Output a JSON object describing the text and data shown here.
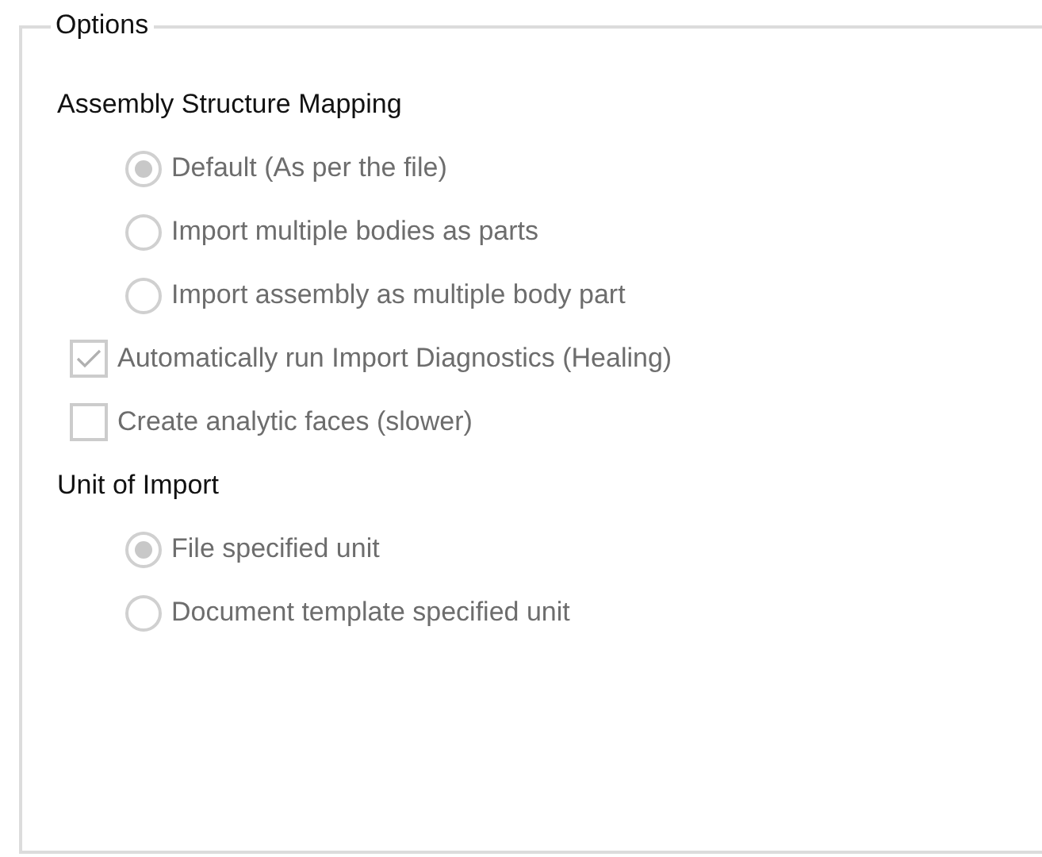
{
  "group": {
    "title": "Options"
  },
  "items": [
    {
      "kind": "heading",
      "label": "Assembly Structure Mapping"
    },
    {
      "kind": "radio",
      "label": "Default (As per the file)",
      "selected": true,
      "disabled": true
    },
    {
      "kind": "radio",
      "label": "Import multiple bodies as parts",
      "selected": false,
      "disabled": true
    },
    {
      "kind": "radio",
      "label": "Import assembly as multiple body part",
      "selected": false,
      "disabled": true
    },
    {
      "kind": "checkbox",
      "label": "Automatically run Import Diagnostics (Healing)",
      "checked": true,
      "disabled": true
    },
    {
      "kind": "checkbox",
      "label": "Create analytic faces (slower)",
      "checked": false,
      "disabled": true
    },
    {
      "kind": "heading",
      "label": "Unit of Import"
    },
    {
      "kind": "radio",
      "label": "File specified unit",
      "selected": true,
      "disabled": true
    },
    {
      "kind": "radio",
      "label": "Document template specified unit",
      "selected": false,
      "disabled": true
    }
  ]
}
